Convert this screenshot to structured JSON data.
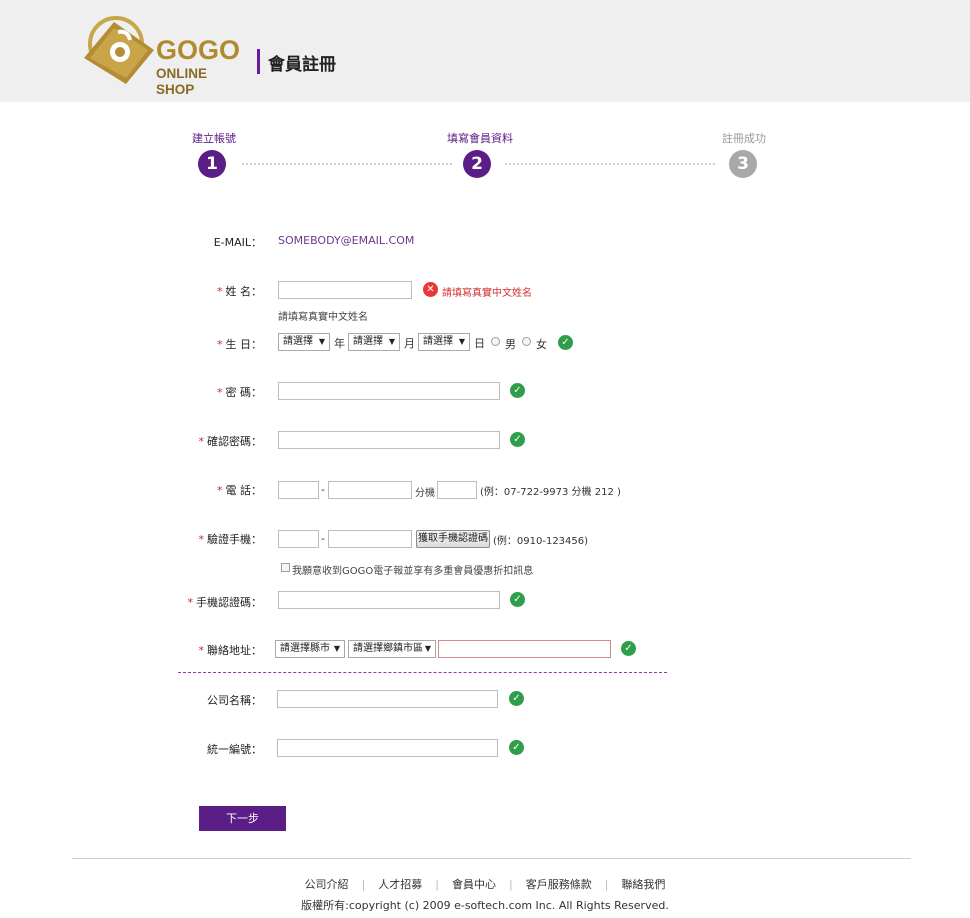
{
  "header": {
    "logo_text_top": "GOGO",
    "logo_text_bottom": "ONLINE SHOP",
    "page_title": "會員註冊",
    "brand_color": "#6a1b9a"
  },
  "steps": [
    {
      "label": "建立帳號",
      "number": "1",
      "state": "done",
      "color": "#5b1d86"
    },
    {
      "label": "填寫會員資料",
      "number": "2",
      "state": "current",
      "color": "#5b1d86"
    },
    {
      "label": "註冊成功",
      "number": "3",
      "state": "pending",
      "color": "#a8a8a8"
    }
  ],
  "form": {
    "email": {
      "label": "E-MAIL：",
      "value": "SOMEBODY@EMAIL.COM"
    },
    "name": {
      "label": "姓 名：",
      "value": "",
      "error": "請填寫真實中文姓名",
      "hint": "請填寫真實中文姓名"
    },
    "birthday": {
      "label": "生 日：",
      "year_select": "請選擇",
      "year_unit": "年",
      "month_select": "請選擇",
      "month_unit": "月",
      "day_select": "請選擇",
      "day_unit": "日",
      "gender_male": "男",
      "gender_female": "女"
    },
    "password": {
      "label": "密 碼："
    },
    "confirm_password": {
      "label": "確認密碼："
    },
    "phone": {
      "label": "電 話：",
      "dash": "-",
      "ext_label": "分機",
      "example": "(例：07-722-9973 分機 212 )"
    },
    "mobile": {
      "label": "驗證手機：",
      "dash": "-",
      "get_code_button": "獲取手機認證碼",
      "example": "(例：0910-123456)"
    },
    "newsletter": {
      "label": "我願意收到GOGO電子報並享有多重會員優惠折扣訊息",
      "checked": false
    },
    "mobile_code": {
      "label": "手機認證碼："
    },
    "address": {
      "label": "聯絡地址：",
      "city_select": "請選擇縣市",
      "district_select": "請選擇鄉鎮市區",
      "value": ""
    },
    "company": {
      "label": "公司名稱："
    },
    "tax_id": {
      "label": "統一編號："
    },
    "required_mark": "*",
    "next_button": "下一步"
  },
  "footer": {
    "links": [
      "公司介紹",
      "人才招募",
      "會員中心",
      "客戶服務條款",
      "聯絡我們"
    ],
    "separator": "|",
    "copyright": "版權所有:copyright (c) 2009 e-softech.com Inc. All Rights Reserved."
  }
}
